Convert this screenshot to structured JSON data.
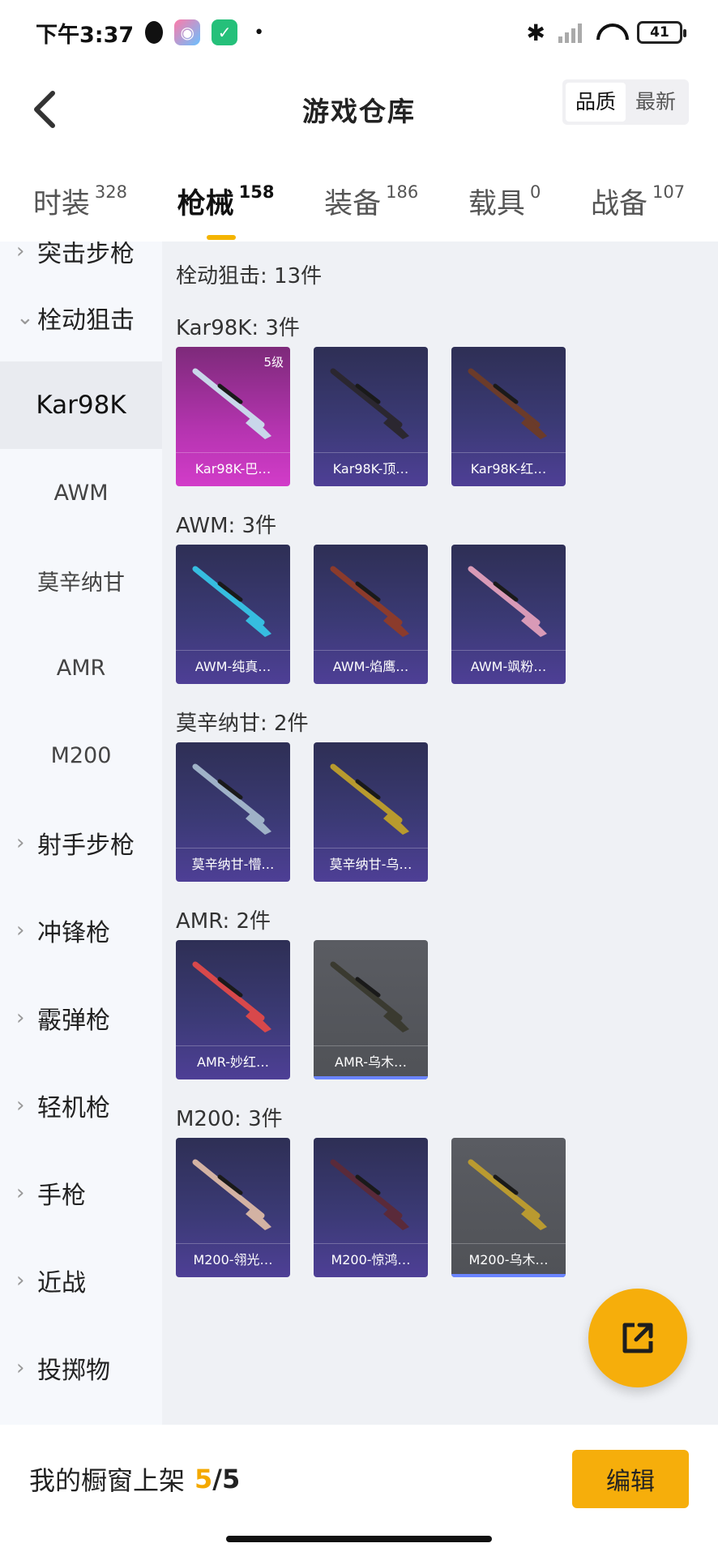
{
  "status_bar": {
    "time": "下午3:37",
    "battery": "41"
  },
  "header": {
    "title": "游戏仓库",
    "sort_options": [
      "品质",
      "最新"
    ],
    "sort_active": "品质"
  },
  "tabs": [
    {
      "label": "时装",
      "count": "328"
    },
    {
      "label": "枪械",
      "count": "158",
      "active": true
    },
    {
      "label": "装备",
      "count": "186"
    },
    {
      "label": "载具",
      "count": "0"
    },
    {
      "label": "战备",
      "count": "107"
    }
  ],
  "sidebar": {
    "cut_item": "突击步枪",
    "groups": [
      {
        "label": "栓动狙击",
        "expanded": true
      },
      {
        "label": "射手步枪"
      },
      {
        "label": "冲锋枪"
      },
      {
        "label": "霰弹枪"
      },
      {
        "label": "轻机枪"
      },
      {
        "label": "手枪"
      },
      {
        "label": "近战"
      },
      {
        "label": "投掷物"
      }
    ],
    "subitems": [
      "Kar98K",
      "AWM",
      "莫辛纳甘",
      "AMR",
      "M200"
    ],
    "selected": "Kar98K"
  },
  "content": {
    "category_header": "栓动狙击: 13件",
    "groups": [
      {
        "title": "Kar98K: 3件",
        "items": [
          {
            "name": "Kar98K-巴…",
            "level": "5级",
            "style": "pink"
          },
          {
            "name": "Kar98K-顶…",
            "style": "purple"
          },
          {
            "name": "Kar98K-红…",
            "style": "purple"
          }
        ]
      },
      {
        "title": "AWM: 3件",
        "items": [
          {
            "name": "AWM-纯真…",
            "style": "purple"
          },
          {
            "name": "AWM-焰鹰…",
            "style": "purple"
          },
          {
            "name": "AWM-飒粉…",
            "style": "purple"
          }
        ]
      },
      {
        "title": "莫辛纳甘: 2件",
        "items": [
          {
            "name": "莫辛纳甘-懵…",
            "style": "purple"
          },
          {
            "name": "莫辛纳甘-乌…",
            "style": "purple"
          }
        ]
      },
      {
        "title": "AMR: 2件",
        "items": [
          {
            "name": "AMR-妙红…",
            "style": "purple"
          },
          {
            "name": "AMR-乌木…",
            "style": "gray"
          }
        ]
      },
      {
        "title": "M200: 3件",
        "items": [
          {
            "name": "M200-翎光…",
            "style": "purple"
          },
          {
            "name": "M200-惊鸿…",
            "style": "purple"
          },
          {
            "name": "M200-乌木…",
            "style": "gray"
          }
        ]
      }
    ]
  },
  "bottom_bar": {
    "label": "我的橱窗上架",
    "count_current": "5",
    "count_total": "/5",
    "edit_label": "编辑"
  },
  "colors": {
    "accent": "#f6ae0b",
    "card_purple": "#3b3a75",
    "card_pink": "#b534b0",
    "card_gray": "#55575c"
  }
}
